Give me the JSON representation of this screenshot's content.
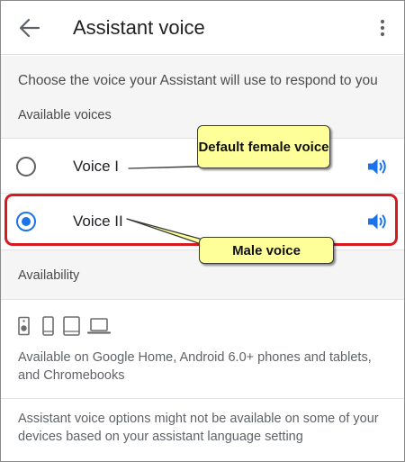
{
  "header": {
    "title": "Assistant voice",
    "back_icon": "arrow-back-icon",
    "more_icon": "more-vert-icon"
  },
  "intro": {
    "description": "Choose the voice your Assistant will use to respond to you",
    "available_voices_heading": "Available voices"
  },
  "voices": [
    {
      "label": "Voice I",
      "selected": false,
      "play_icon": "volume-up-icon"
    },
    {
      "label": "Voice II",
      "selected": true,
      "play_icon": "volume-up-icon"
    }
  ],
  "availability": {
    "heading": "Availability",
    "device_icons": [
      "speaker-icon",
      "phone-icon",
      "tablet-icon",
      "laptop-icon"
    ],
    "description": "Available on Google Home, Android 6.0+ phones and tablets, and Chromebooks"
  },
  "note": "Assistant voice options might not be available on some of your devices based on your assistant language setting",
  "annotations": {
    "callout_default": "Default female voice",
    "callout_male": "Male voice"
  },
  "colors": {
    "accent": "#1a73e8",
    "highlight_border": "#d71920",
    "callout_fill": "#ffff99",
    "section_background": "#f5f5f5"
  }
}
